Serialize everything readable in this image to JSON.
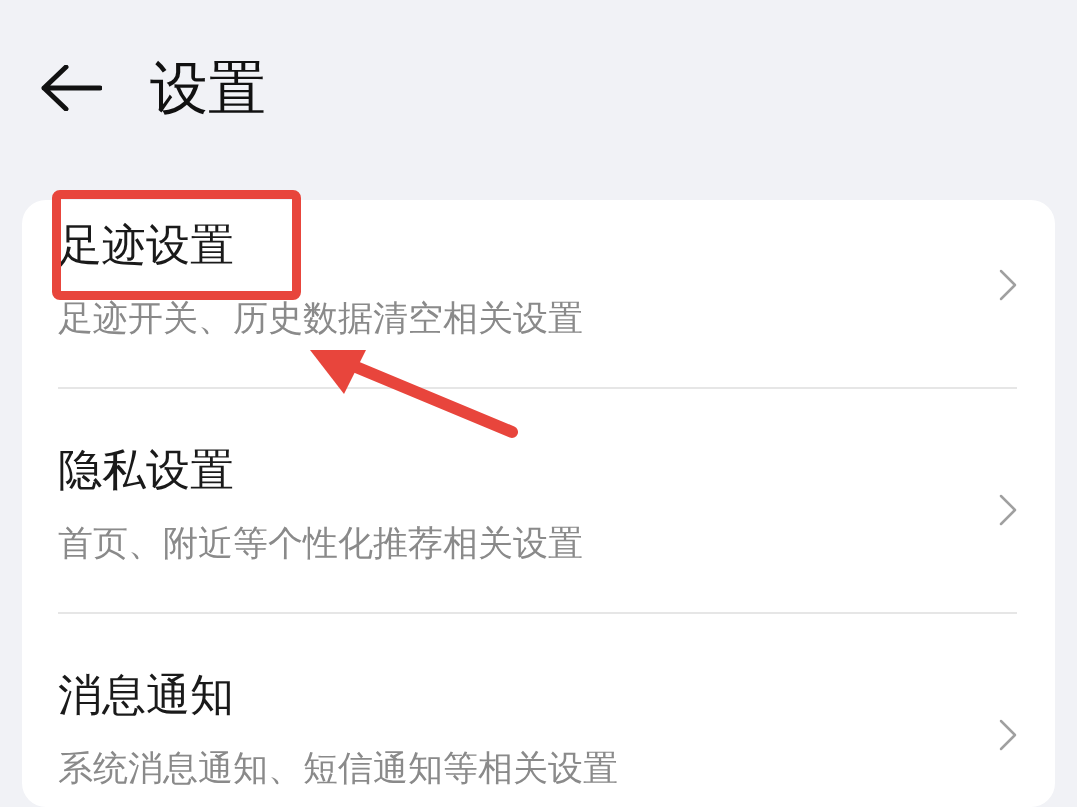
{
  "header": {
    "title": "设置"
  },
  "items": [
    {
      "title": "足迹设置",
      "subtitle": "足迹开关、历史数据清空相关设置"
    },
    {
      "title": "隐私设置",
      "subtitle": "首页、附近等个性化推荐相关设置"
    },
    {
      "title": "消息通知",
      "subtitle": "系统消息通知、短信通知等相关设置"
    }
  ],
  "annotations": {
    "highlight_box": true,
    "arrow": true
  }
}
